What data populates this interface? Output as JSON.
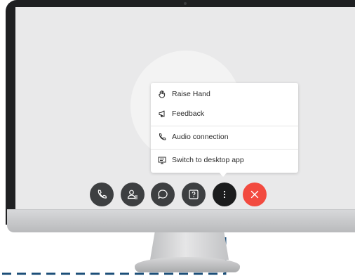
{
  "menu": {
    "items": [
      {
        "label": "Raise Hand",
        "icon": "raise-hand-icon"
      },
      {
        "label": "Feedback",
        "icon": "megaphone-icon"
      },
      {
        "label": "Audio connection",
        "icon": "phone-icon"
      },
      {
        "label": "Switch to desktop app",
        "icon": "desktop-app-icon"
      }
    ]
  },
  "controls": [
    {
      "name": "audio",
      "icon": "phone-icon"
    },
    {
      "name": "participants",
      "icon": "participants-icon"
    },
    {
      "name": "chat",
      "icon": "chat-bubble-icon"
    },
    {
      "name": "help",
      "icon": "help-icon"
    },
    {
      "name": "more",
      "icon": "more-dots-icon"
    },
    {
      "name": "leave",
      "icon": "close-icon"
    }
  ],
  "colors": {
    "leave": "#f24a3f",
    "control": "#3d3f41",
    "guide": "#1c4f79"
  }
}
